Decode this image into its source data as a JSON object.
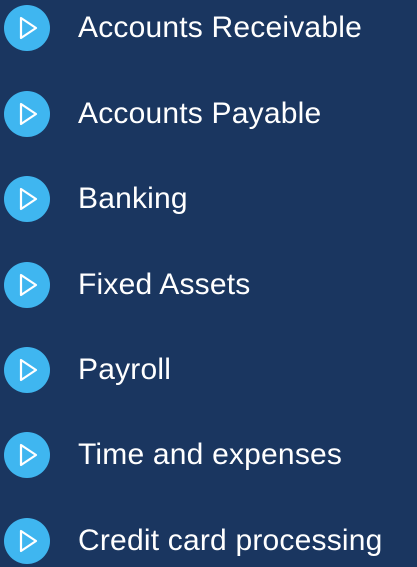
{
  "menu": {
    "items": [
      {
        "label": "Accounts Receivable",
        "icon": "play-icon"
      },
      {
        "label": "Accounts Payable",
        "icon": "play-icon"
      },
      {
        "label": "Banking",
        "icon": "play-icon"
      },
      {
        "label": "Fixed Assets",
        "icon": "play-icon"
      },
      {
        "label": "Payroll",
        "icon": "play-icon"
      },
      {
        "label": "Time and expenses",
        "icon": "play-icon"
      },
      {
        "label": "Credit card processing",
        "icon": "play-icon"
      }
    ]
  },
  "colors": {
    "background": "#1a3660",
    "icon_circle": "#3fb6f0",
    "icon_glyph": "#ffffff",
    "text": "#ffffff"
  }
}
